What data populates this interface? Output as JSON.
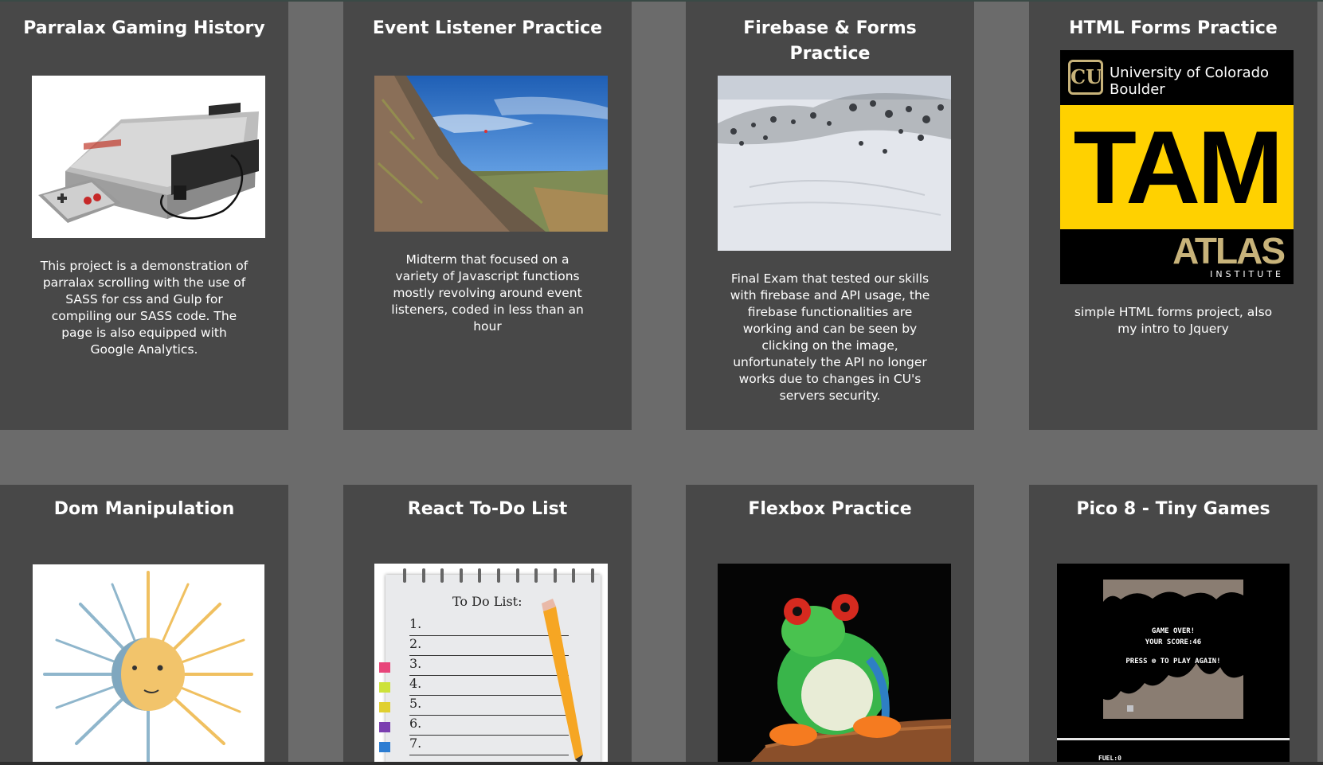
{
  "projects": [
    {
      "title": "Parralax Gaming History",
      "image_alt": "NES console",
      "description": "This project is a demonstration of parralax scrolling with the use of SASS for css and Gulp for compiling our SASS code. The page is also equipped with Google Analytics."
    },
    {
      "title": "Event Listener Practice",
      "image_alt": "Climber on Flatirons",
      "description": "Midterm that focused on a variety of Javascript functions mostly revolving around event listeners, coded in less than an hour"
    },
    {
      "title": "Firebase & Forms Practice",
      "image_alt": "Snowy mountainside",
      "description": "Final Exam that tested our skills with firebase and API usage, the firebase functionalities are working and can be seen by clicking on the image, unfortunately the API no longer works due to changes in CU's servers security."
    },
    {
      "title": "HTML Forms Practice",
      "image_alt": "CU Boulder TAM ATLAS logo",
      "logo_university": "University of Colorado",
      "logo_campus": "Boulder",
      "logo_tam": "TAM",
      "logo_atlas": "ATLAS",
      "logo_institute": "INSTITUTE",
      "description": "simple HTML forms project, also my intro to Jquery"
    },
    {
      "title": "Dom Manipulation",
      "image_alt": "Sun and moon illustration",
      "description": ""
    },
    {
      "title": "React To-Do List",
      "image_alt": "To do list notepad",
      "todo_heading": "To Do List:",
      "todo_items": [
        "1.",
        "2.",
        "3.",
        "4.",
        "5.",
        "6.",
        "7."
      ],
      "description": ""
    },
    {
      "title": "Flexbox Practice",
      "image_alt": "Red-eyed tree frog",
      "description": ""
    },
    {
      "title": "Pico 8 - Tiny Games",
      "image_alt": "Pico 8 game over screen",
      "game_over": "GAME OVER!",
      "score": "YOUR SCORE:46",
      "press": "PRESS ⊗ TO PLAY AGAIN!",
      "fuel": "FUEL:0",
      "description": ""
    }
  ],
  "colors": {
    "page_bg": "#6b6b6b",
    "card_bg": "#484848",
    "text": "#ffffff",
    "tam_yellow": "#ffd100"
  }
}
